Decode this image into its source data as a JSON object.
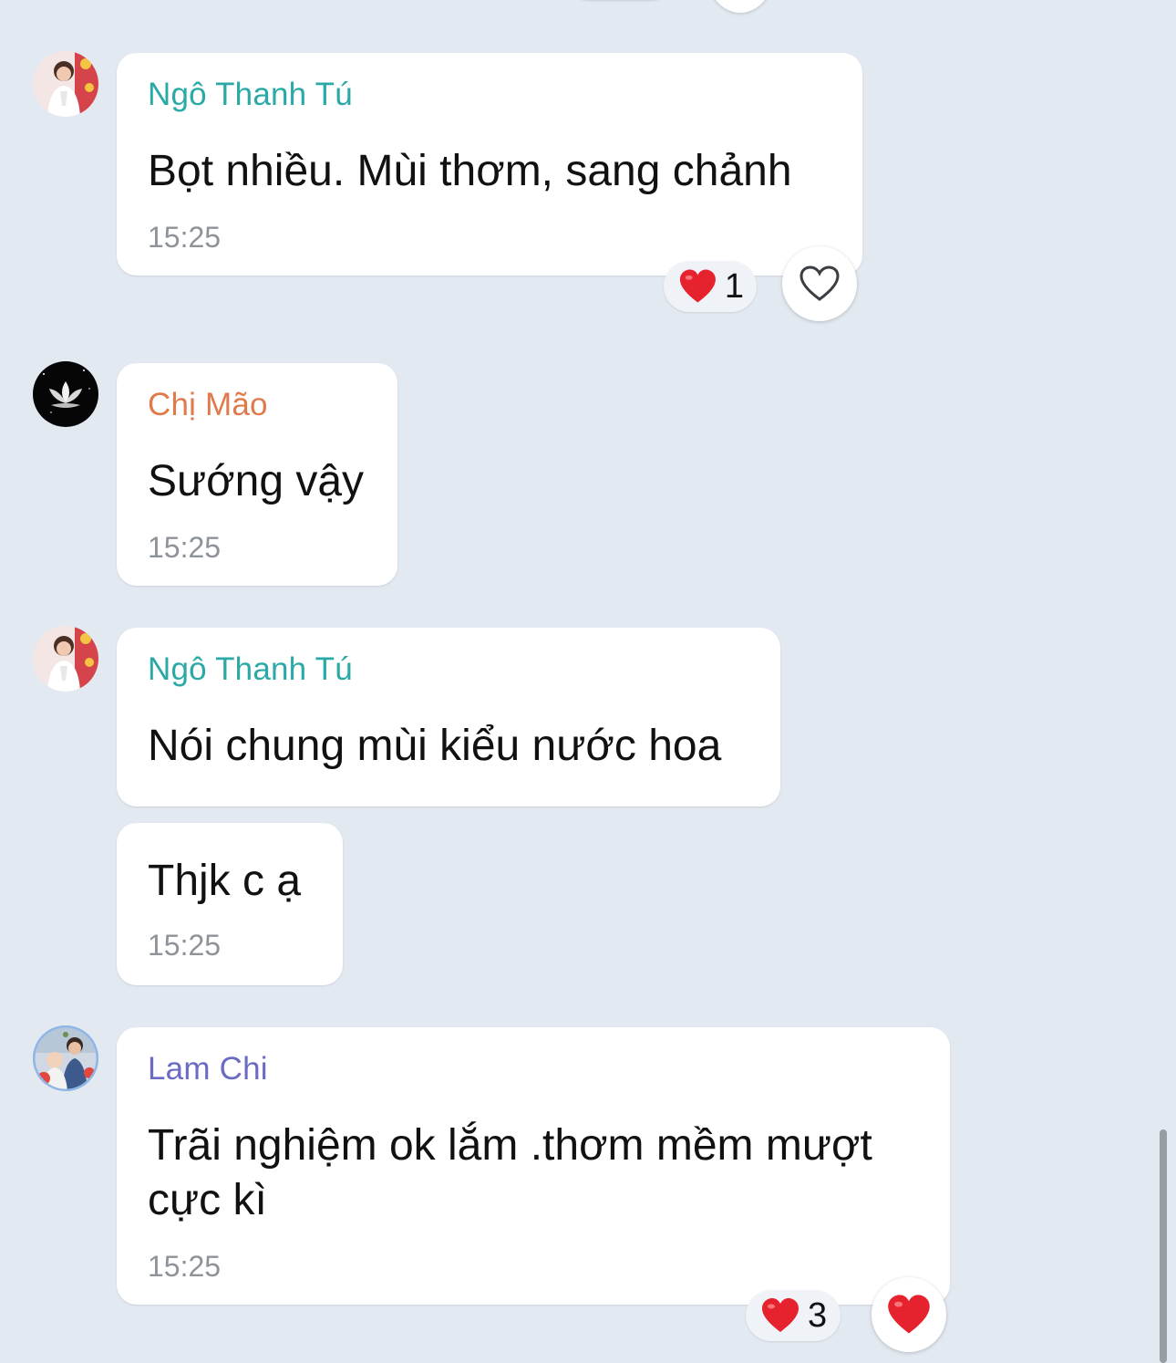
{
  "colors": {
    "background": "#e3e9f1",
    "sender_teal": "#2aa9a7",
    "sender_orange": "#e07a4b",
    "sender_purple": "#6a6bc4",
    "heart_red": "#e5222d",
    "timestamp_gray": "#8e939a"
  },
  "messages": [
    {
      "sender": "Ngô Thanh Tú",
      "text": "Bọt nhiều. Mùi thơm, sang chảnh",
      "time": "15:25",
      "reactions": {
        "icon": "heart-emoji",
        "count": "1",
        "my_reaction_icon": "heart-outline-icon"
      }
    },
    {
      "sender": "Chị Mão",
      "text": "Sướng vậy",
      "time": "15:25"
    },
    {
      "sender": "Ngô Thanh Tú",
      "text": "Nói chung mùi kiểu nước hoa"
    },
    {
      "text": "Thjk c ạ",
      "time": "15:25"
    },
    {
      "sender": "Lam Chi",
      "text": "Trãi nghiệm ok lắm .thơm mềm mượt\ncực kì",
      "time": "15:25",
      "reactions": {
        "icon": "heart-emoji",
        "count": "3",
        "my_reaction_icon": "heart-filled-icon"
      }
    }
  ]
}
